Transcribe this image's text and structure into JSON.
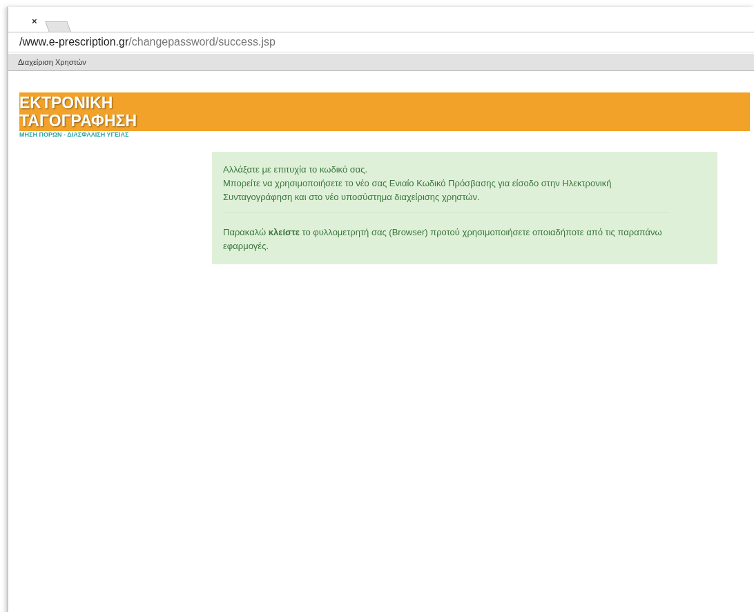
{
  "browser": {
    "tab_close": "×",
    "url_host": "/www.e-prescription.gr",
    "url_path": "/changepassword/success.jsp",
    "bookmarks": [
      "Διαχείριση Χρηστών"
    ]
  },
  "banner": {
    "logo_lines": [
      "ΕΚΤΡΟΝΙΚΗ",
      "ΤΑΓΟΓΡΑΦΗΣΗ"
    ],
    "tagline": "ΜΗΣΗ ΠΟΡΩΝ - ΔΙΑΣΦΑΛΙΣΗ ΥΓΕΙΑΣ"
  },
  "message": {
    "paragraphs": [
      [
        "Αλλάξατε με επιτυχία το κωδικό σας.",
        "Μπορείτε να χρησιμοποιήσετε το νέο σας Ενιαίο Κωδικό Πρόσβασης για είσοδο στην Ηλεκτρονική Συνταγογράφηση και στο νέο υποσύστημα διαχείρισης χρηστών."
      ],
      [
        "Παρακαλώ **κλείστε** το φυλλομετρητή σας (Browser) προτού χρησιμοποιήσετε οποιαδήποτε από τις παραπάνω εφαρμογές."
      ]
    ]
  }
}
